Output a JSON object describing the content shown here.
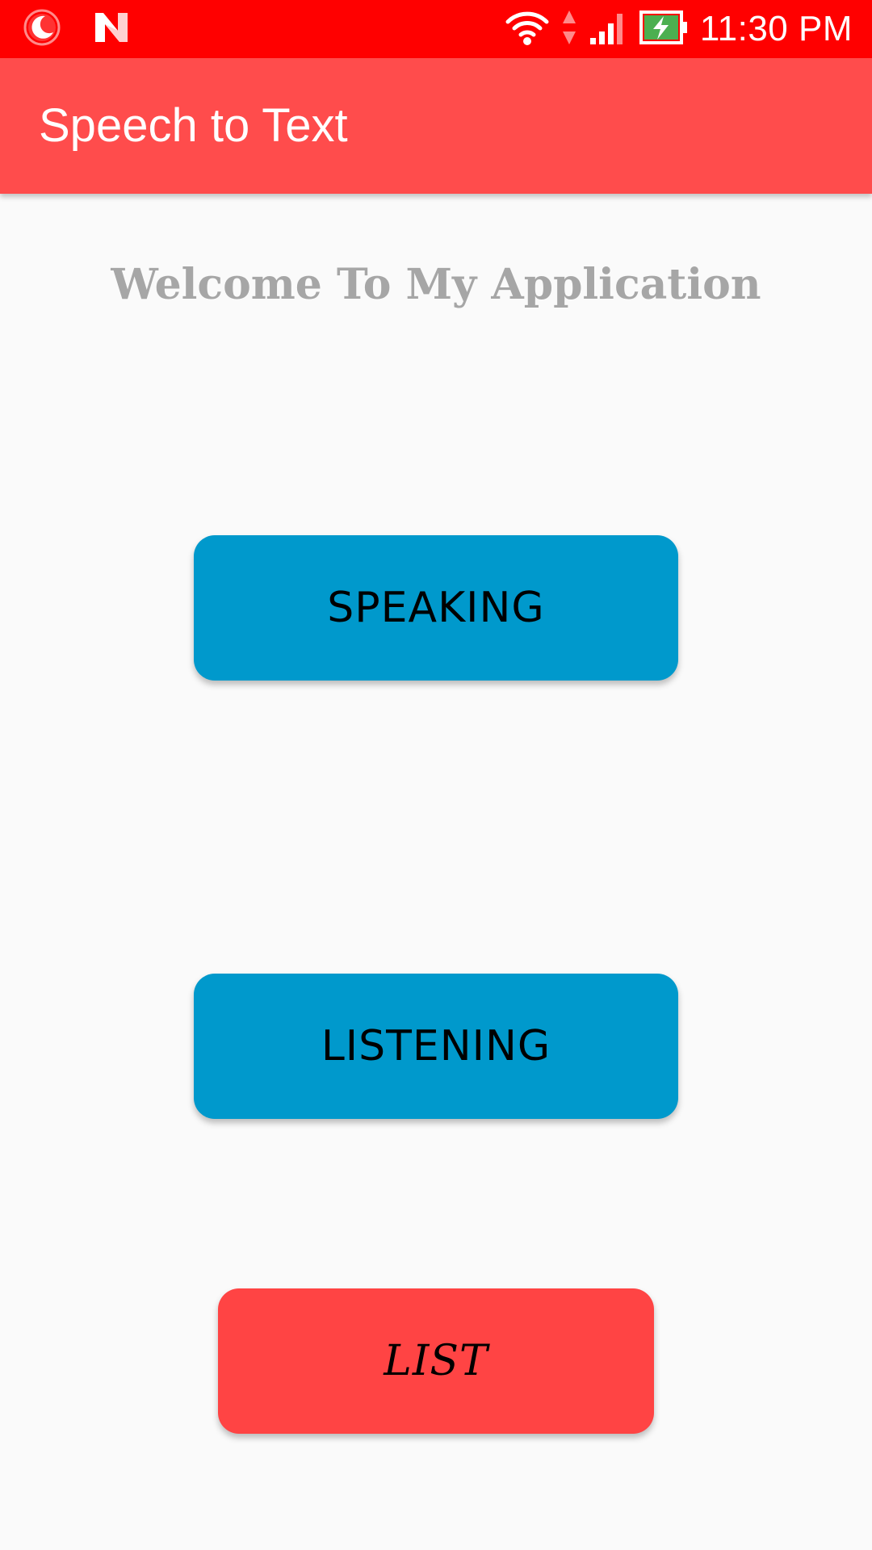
{
  "status_bar": {
    "time": "11:30 PM",
    "background": "#ff0000",
    "icons": [
      "moon-icon",
      "n-logo-icon",
      "wifi-icon",
      "data-arrows-icon",
      "cell-signal-icon",
      "battery-charging-icon"
    ]
  },
  "app_bar": {
    "title": "Speech to Text",
    "background": "#ff4c4c"
  },
  "main": {
    "welcome": "Welcome To My Application",
    "buttons": {
      "speaking": "SPEAKING",
      "listening": "LISTENING",
      "list": "LIST"
    },
    "colors": {
      "primary_button": "#0099cc",
      "list_button": "#ff4444",
      "welcome_text": "#a6a6a6"
    }
  }
}
